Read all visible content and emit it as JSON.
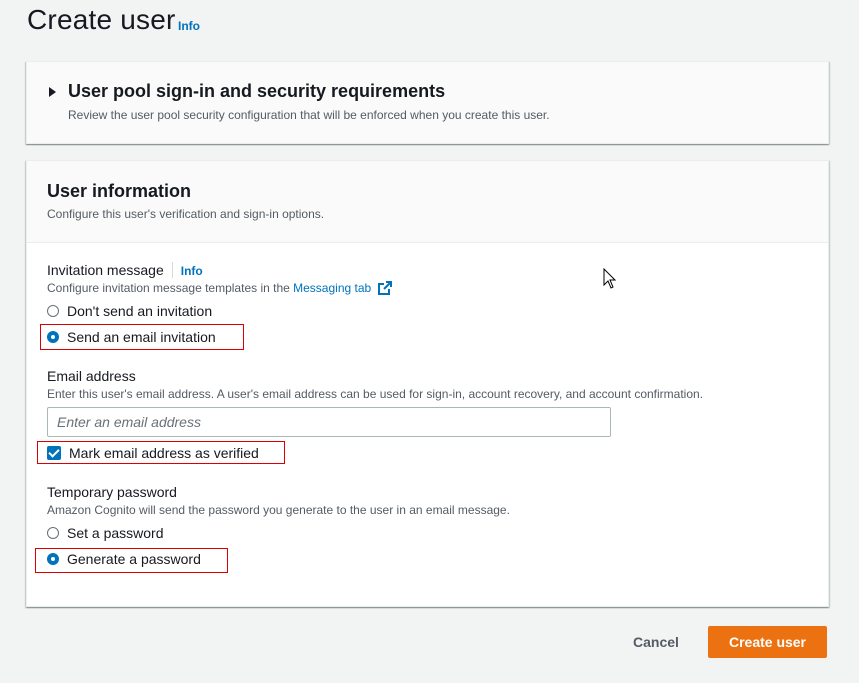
{
  "page": {
    "title": "Create user",
    "info": "Info"
  },
  "security_section": {
    "title": "User pool sign-in and security requirements",
    "description": "Review the user pool security configuration that will be enforced when you create this user."
  },
  "user_info": {
    "title": "User information",
    "description": "Configure this user's verification and sign-in options.",
    "invitation": {
      "label": "Invitation message",
      "info": "Info",
      "description_prefix": "Configure invitation message templates in the ",
      "link": "Messaging tab",
      "options": [
        {
          "label": "Don't send an invitation",
          "selected": false
        },
        {
          "label": "Send an email invitation",
          "selected": true
        }
      ]
    },
    "email": {
      "label": "Email address",
      "description": "Enter this user's email address. A user's email address can be used for sign-in, account recovery, and account confirmation.",
      "placeholder": "Enter an email address",
      "value": "",
      "verified_label": "Mark email address as verified",
      "verified_checked": true
    },
    "password": {
      "label": "Temporary password",
      "description": "Amazon Cognito will send the password you generate to the user in an email message.",
      "options": [
        {
          "label": "Set a password",
          "selected": false
        },
        {
          "label": "Generate a password",
          "selected": true
        }
      ]
    }
  },
  "actions": {
    "cancel": "Cancel",
    "create": "Create user"
  },
  "colors": {
    "accent": "#0073bb",
    "primary_button": "#ec7211",
    "highlight_box": "#dd0000"
  }
}
